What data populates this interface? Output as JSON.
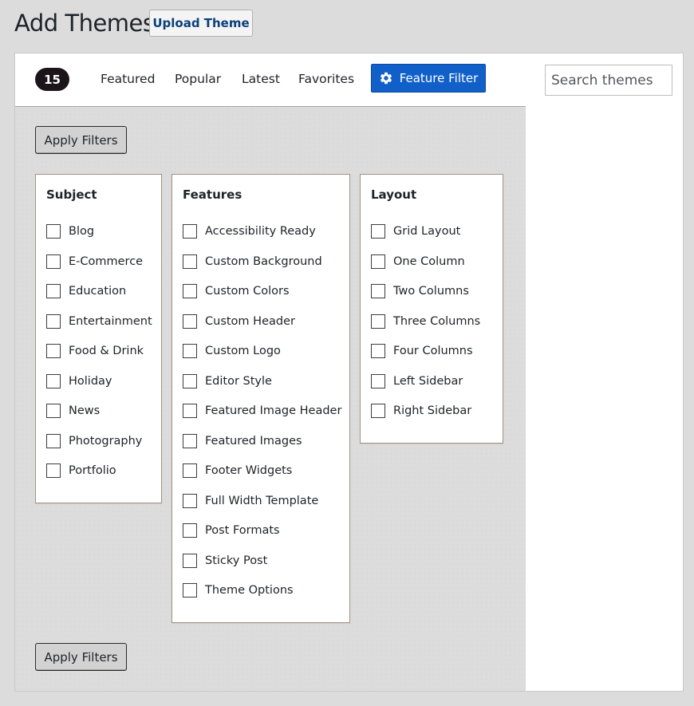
{
  "header": {
    "title": "Add Themes",
    "upload_label": "Upload Theme"
  },
  "filter_bar": {
    "count": "15",
    "tabs": [
      "Featured",
      "Popular",
      "Latest",
      "Favorites"
    ],
    "feature_filter_label": "Feature Filter",
    "feature_filter_icon": "gear-icon",
    "active_color": "#1160c9"
  },
  "search": {
    "placeholder": "Search themes...",
    "value": ""
  },
  "apply_label": "Apply Filters",
  "groups": {
    "subject": {
      "title": "Subject",
      "options": [
        "Blog",
        "E-Commerce",
        "Education",
        "Entertainment",
        "Food & Drink",
        "Holiday",
        "News",
        "Photography",
        "Portfolio"
      ]
    },
    "features": {
      "title": "Features",
      "options": [
        "Accessibility Ready",
        "Custom Background",
        "Custom Colors",
        "Custom Header",
        "Custom Logo",
        "Editor Style",
        "Featured Image Header",
        "Featured Images",
        "Footer Widgets",
        "Full Width Template",
        "Post Formats",
        "Sticky Post",
        "Theme Options"
      ]
    },
    "layout": {
      "title": "Layout",
      "options": [
        "Grid Layout",
        "One Column",
        "Two Columns",
        "Three Columns",
        "Four Columns",
        "Left Sidebar",
        "Right Sidebar"
      ]
    }
  }
}
